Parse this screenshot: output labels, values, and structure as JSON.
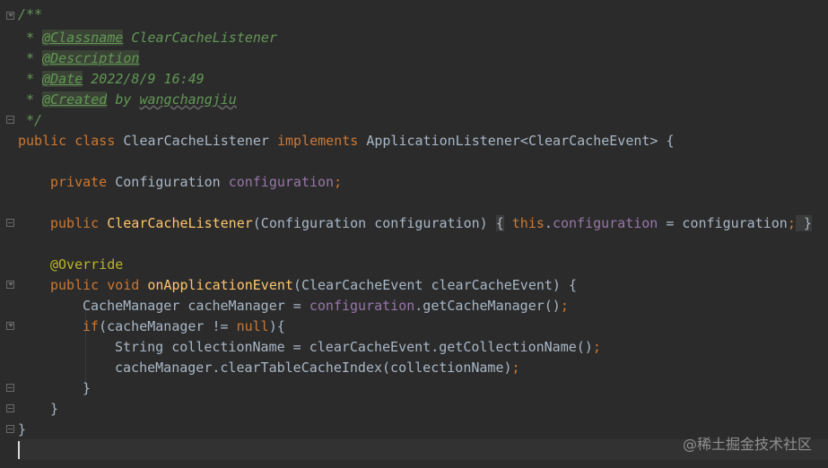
{
  "code": {
    "l1": "/**",
    "l2_prefix": " * ",
    "l2_tag": "@Classname",
    "l2_text": " ClearCacheListener",
    "l3_prefix": " * ",
    "l3_tag": "@Description",
    "l4_prefix": " * ",
    "l4_tag": "@Date",
    "l4_text": " 2022/8/9 16:49",
    "l5_prefix": " * ",
    "l5_tag": "@Created",
    "l5_by": " by ",
    "l5_author": "wangchangjiu",
    "l6": " */",
    "l7_kw1": "public class",
    "l7_name": " ClearCacheListener ",
    "l7_kw2": "implements",
    "l7_rest": " ApplicationListener<ClearCacheEvent> {",
    "l9_kw": "private",
    "l9_type": " Configuration ",
    "l9_field": "configuration",
    "l9_semi": ";",
    "l11_kw": "public",
    "l11_ctor": " ClearCacheListener",
    "l11_params": "(Configuration configuration) ",
    "l11_open": "{",
    "l11_this": " this",
    "l11_dot": ".",
    "l11_field": "configuration",
    "l11_assign": " = configuration",
    "l11_semi": ";",
    "l11_close": " }",
    "l13_ann": "@Override",
    "l14_kw": "public void",
    "l14_fn": " onApplicationEvent",
    "l14_rest": "(ClearCacheEvent clearCacheEvent) {",
    "l15_a": "CacheManager cacheManager = ",
    "l15_field": "configuration",
    "l15_b": ".getCacheManager()",
    "l15_semi": ";",
    "l16_kw": "if",
    "l16_a": "(cacheManager != ",
    "l16_null": "null",
    "l16_b": "){",
    "l17_a": "String collectionName = clearCacheEvent.getCollectionName()",
    "l17_semi": ";",
    "l18_a": "cacheManager.clearTableCacheIndex(collectionName)",
    "l18_semi": ";",
    "l19": "}",
    "l20": "}",
    "l21": "}"
  },
  "watermark": "@稀土掘金技术社区",
  "colors": {
    "background": "#2b2b2b",
    "keyword": "#cc7832",
    "doc_comment": "#629755",
    "field": "#9876aa",
    "method": "#ffc66d",
    "annotation": "#bbb529",
    "text": "#a9b7c6"
  }
}
